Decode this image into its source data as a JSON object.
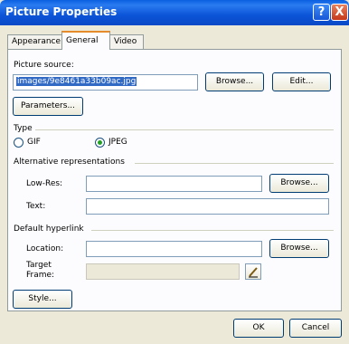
{
  "window": {
    "title": "Picture Properties"
  },
  "titlebar": {
    "help": "?",
    "close": "X"
  },
  "tabs": [
    {
      "label": "Appearance"
    },
    {
      "label": "General"
    },
    {
      "label": "Video"
    }
  ],
  "general": {
    "picture_source_label": "Picture source:",
    "picture_source_value": "images/9e8461a33b09ac.jpg",
    "browse_label": "Browse...",
    "edit_label": "Edit...",
    "parameters_label": "Parameters...",
    "type_label": "Type",
    "type_gif_label": "GIF",
    "type_jpeg_label": "JPEG",
    "selected_type": "JPEG",
    "alt_rep_label": "Alternative representations",
    "low_res_label": "Low-Res:",
    "low_res_value": "",
    "low_res_browse_label": "Browse...",
    "text_label": "Text:",
    "text_value": "",
    "default_hyperlink_label": "Default hyperlink",
    "location_label": "Location:",
    "location_value": "",
    "location_browse_label": "Browse...",
    "target_frame_label_line1": "Target",
    "target_frame_label_line2": "Frame:",
    "target_frame_value": "",
    "style_label": "Style..."
  },
  "footer": {
    "ok_label": "OK",
    "cancel_label": "Cancel"
  }
}
